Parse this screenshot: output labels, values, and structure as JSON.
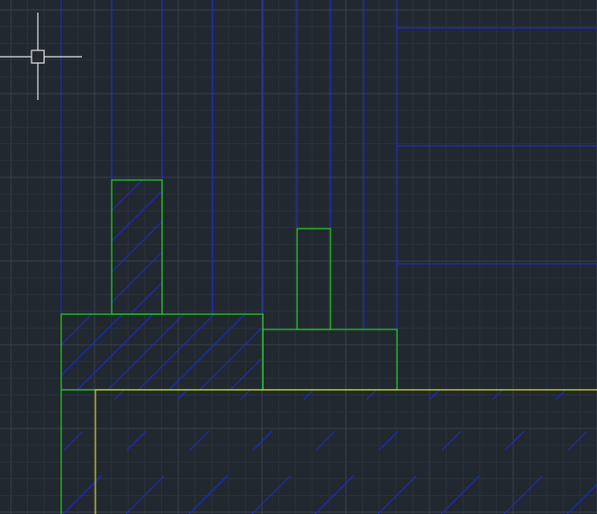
{
  "app": {
    "view": "cad-model-space"
  },
  "colors": {
    "background": "#212830",
    "grid_minor": "#2b323a",
    "grid_major": "#39414b",
    "blue_lines": "#1d2bd0",
    "green_lines": "#20d420",
    "yellow_line": "#d8d020",
    "hatch": "#1e2bd0",
    "crosshair": "#e8e8e8"
  },
  "cursor": {
    "icon": "crosshair-cursor-icon",
    "pickbox_icon": "pickbox-square-icon"
  }
}
